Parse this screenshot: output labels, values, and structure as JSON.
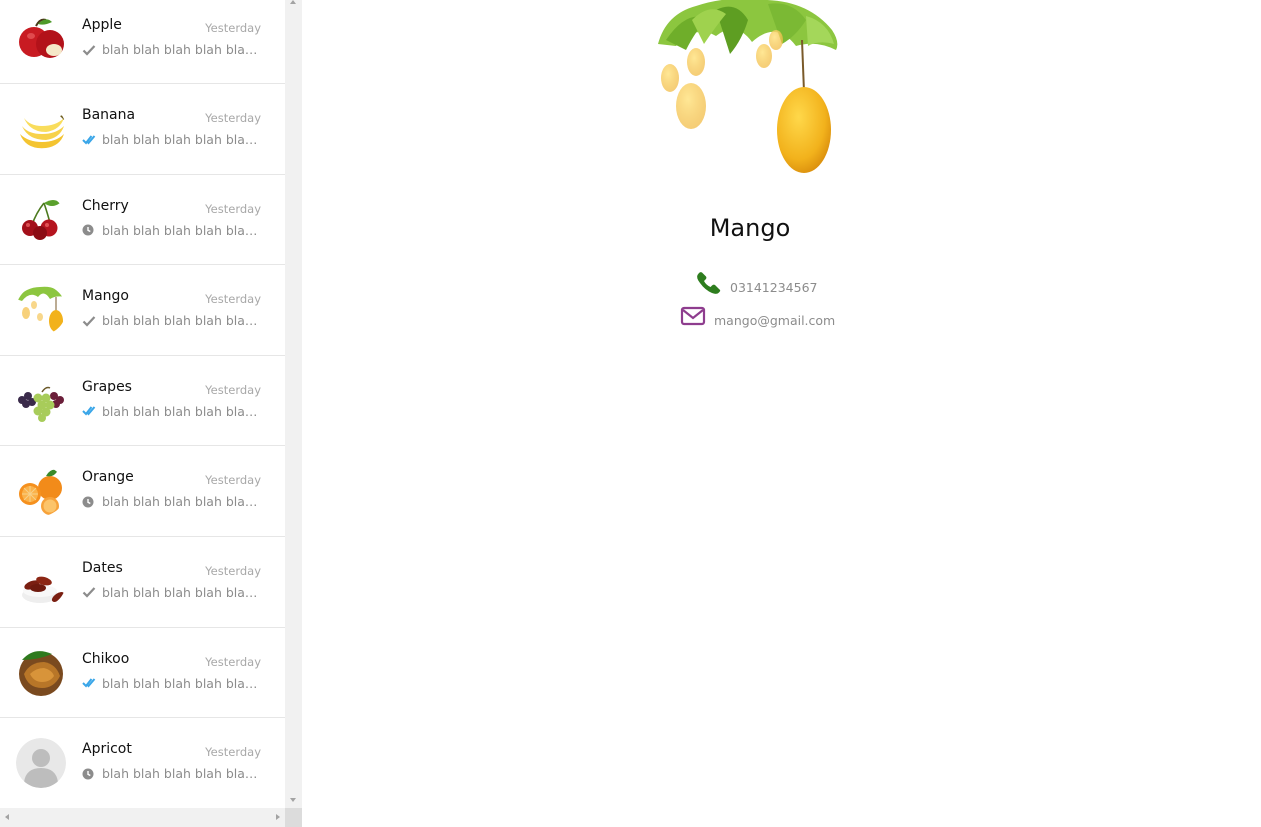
{
  "sidebar": {
    "chats": [
      {
        "name": "Apple",
        "time": "Yesterday",
        "preview": "blah blah blah blah blah blah",
        "status": "sent",
        "avatar": "apple"
      },
      {
        "name": "Banana",
        "time": "Yesterday",
        "preview": "blah blah blah blah blah blah",
        "status": "read",
        "avatar": "banana"
      },
      {
        "name": "Cherry",
        "time": "Yesterday",
        "preview": "blah blah blah blah blah blah",
        "status": "pending",
        "avatar": "cherry"
      },
      {
        "name": "Mango",
        "time": "Yesterday",
        "preview": "blah blah blah blah blah blah",
        "status": "sent",
        "avatar": "mango"
      },
      {
        "name": "Grapes",
        "time": "Yesterday",
        "preview": "blah blah blah blah blah blah",
        "status": "read",
        "avatar": "grapes"
      },
      {
        "name": "Orange",
        "time": "Yesterday",
        "preview": "blah blah blah blah blah blah",
        "status": "pending",
        "avatar": "orange"
      },
      {
        "name": "Dates",
        "time": "Yesterday",
        "preview": "blah blah blah blah blah blah",
        "status": "sent",
        "avatar": "dates"
      },
      {
        "name": "Chikoo",
        "time": "Yesterday",
        "preview": "blah blah blah blah blah blah",
        "status": "read",
        "avatar": "chikoo"
      },
      {
        "name": "Apricot",
        "time": "Yesterday",
        "preview": "blah blah blah blah blah blah",
        "status": "pending",
        "avatar": "default-user"
      }
    ]
  },
  "profile": {
    "name": "Mango",
    "phone": "03141234567",
    "email": "mango@gmail.com",
    "phone_icon": "phone-icon",
    "email_icon": "envelope-icon"
  },
  "colors": {
    "phone_icon": "#2e7d1e",
    "email_icon": "#8e3d8e",
    "read_tick": "#3aa6e8",
    "sent_tick": "#8c8c8c"
  }
}
